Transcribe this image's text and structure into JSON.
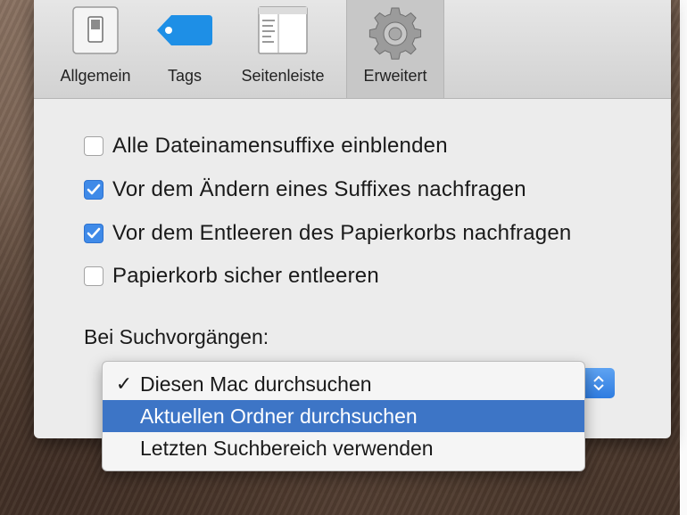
{
  "toolbar": {
    "items": [
      {
        "label": "Allgemein",
        "icon": "general-switch-icon",
        "selected": false
      },
      {
        "label": "Tags",
        "icon": "tag-icon",
        "selected": false
      },
      {
        "label": "Seitenleiste",
        "icon": "sidebar-icon",
        "selected": false
      },
      {
        "label": "Erweitert",
        "icon": "gear-icon",
        "selected": true
      }
    ]
  },
  "options": [
    {
      "label": "Alle Dateinamensuffixe einblenden",
      "checked": false
    },
    {
      "label": "Vor dem Ändern eines Suffixes nachfragen",
      "checked": true
    },
    {
      "label": "Vor dem Entleeren des Papierkorbs nachfragen",
      "checked": true
    },
    {
      "label": "Papierkorb sicher entleeren",
      "checked": false
    }
  ],
  "search": {
    "label": "Bei Suchvorgängen:",
    "menu": [
      {
        "label": "Diesen Mac durchsuchen",
        "checked": true,
        "highlighted": false
      },
      {
        "label": "Aktuellen Ordner durchsuchen",
        "checked": false,
        "highlighted": true
      },
      {
        "label": "Letzten Suchbereich verwenden",
        "checked": false,
        "highlighted": false
      }
    ]
  },
  "colors": {
    "accent": "#3f8ae8",
    "menu_highlight": "#3d75c6",
    "tag_blue": "#1e8fe6"
  }
}
